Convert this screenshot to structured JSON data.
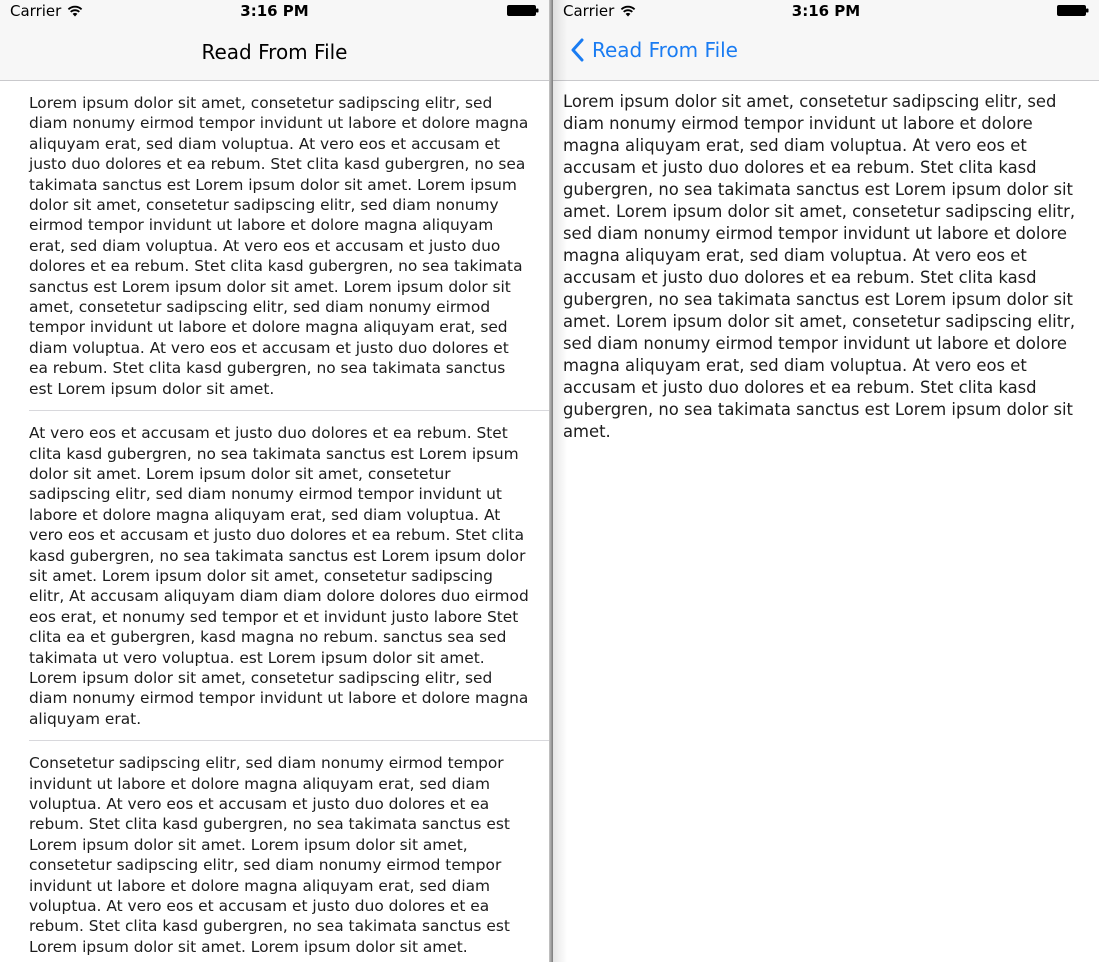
{
  "status_bar": {
    "carrier": "Carrier",
    "time": "3:16 PM"
  },
  "left_screen": {
    "nav_title": "Read From File",
    "cells": [
      "Lorem ipsum dolor sit amet, consetetur sadipscing elitr,  sed diam nonumy eirmod tempor invidunt ut labore et dolore magna aliquyam erat, sed diam voluptua. At vero eos et accusam et justo duo dolores et ea rebum. Stet clita kasd gubergren, no sea takimata sanctus est Lorem ipsum dolor sit amet. Lorem ipsum dolor sit amet, consetetur sadipscing elitr, sed diam nonumy eirmod tempor invidunt ut labore et dolore magna aliquyam erat, sed diam voluptua. At vero eos et accusam et justo duo dolores et ea rebum. Stet clita kasd gubergren, no sea takimata sanctus est Lorem ipsum dolor sit amet. Lorem ipsum dolor sit amet, consetetur sadipscing elitr, sed diam nonumy eirmod tempor invidunt ut labore et dolore magna aliquyam erat, sed diam voluptua. At vero eos et accusam et justo duo dolores et ea rebum. Stet clita kasd gubergren, no sea takimata sanctus est Lorem ipsum dolor sit amet.",
      "At vero eos et accusam et justo duo dolores et ea rebum. Stet clita kasd gubergren, no sea takimata sanctus est Lorem ipsum dolor sit amet. Lorem ipsum dolor sit amet, consetetur sadipscing elitr,  sed diam nonumy eirmod tempor invidunt ut labore et dolore magna aliquyam erat, sed diam voluptua. At vero eos et accusam et justo duo dolores et ea rebum. Stet clita kasd gubergren, no sea takimata sanctus est Lorem ipsum dolor sit amet. Lorem ipsum dolor sit amet, consetetur sadipscing elitr,  At accusam aliquyam diam diam dolore dolores duo eirmod eos erat, et nonumy sed tempor et et invidunt justo labore Stet clita ea et gubergren, kasd magna no rebum. sanctus sea sed takimata ut vero voluptua. est Lorem ipsum dolor sit amet. Lorem ipsum dolor sit amet, consetetur sadipscing elitr,  sed diam nonumy eirmod tempor invidunt ut labore et dolore magna aliquyam erat.",
      "Consetetur sadipscing elitr,  sed diam nonumy eirmod tempor invidunt ut labore et dolore magna aliquyam erat, sed diam voluptua. At vero eos et accusam et justo duo dolores et ea rebum. Stet clita kasd gubergren, no sea takimata sanctus est Lorem ipsum dolor sit amet. Lorem ipsum dolor sit amet, consetetur sadipscing elitr,  sed diam nonumy eirmod tempor invidunt ut labore et dolore magna aliquyam erat, sed diam voluptua. At vero eos et accusam et justo duo dolores et ea rebum. Stet clita kasd gubergren, no sea takimata sanctus est Lorem ipsum dolor sit amet. Lorem ipsum dolor sit amet."
    ]
  },
  "right_screen": {
    "back_label": "Read From File",
    "detail_text": "Lorem ipsum dolor sit amet, consetetur sadipscing elitr,  sed diam nonumy eirmod tempor invidunt ut labore et dolore magna aliquyam erat, sed diam voluptua. At vero eos et accusam et justo duo dolores et ea rebum. Stet clita kasd gubergren, no sea takimata sanctus est Lorem ipsum dolor sit amet. Lorem ipsum dolor sit amet, consetetur sadipscing elitr, sed diam nonumy eirmod tempor invidunt ut labore et dolore magna aliquyam erat, sed diam voluptua. At vero eos et accusam et justo duo dolores et ea rebum. Stet clita kasd gubergren, no sea takimata sanctus est Lorem ipsum dolor sit amet. Lorem ipsum dolor sit amet, consetetur sadipscing elitr, sed diam nonumy eirmod tempor invidunt ut labore et dolore magna aliquyam erat, sed diam voluptua. At vero eos et accusam et justo duo dolores et ea rebum. Stet clita kasd gubergren, no sea takimata sanctus est Lorem ipsum dolor sit amet."
  },
  "colors": {
    "accent": "#1a7cf2",
    "nav_background": "#f7f7f7",
    "separator": "#d8d8dc",
    "text": "#1c1c1c"
  },
  "icons": {
    "wifi": "wifi-icon",
    "battery": "battery-icon",
    "back": "chevron-left-icon"
  }
}
